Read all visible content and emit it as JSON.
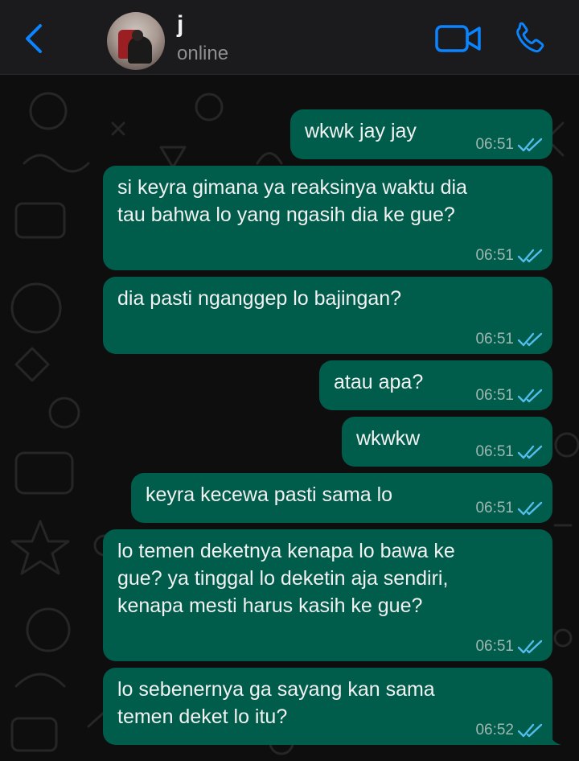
{
  "header": {
    "back_icon": "chevron-left-icon",
    "contact_name": "j",
    "contact_status": "online",
    "video_icon": "video-camera-icon",
    "call_icon": "phone-icon",
    "accent_color": "#0a84ff"
  },
  "messages": [
    {
      "text": "wkwk jay jay",
      "time": "06:51",
      "status": "read"
    },
    {
      "text": "si keyra gimana ya reaksinya waktu dia\ntau bahwa lo yang ngasih dia ke gue?",
      "time": "06:51",
      "status": "read"
    },
    {
      "text": "dia pasti nganggep lo bajingan?",
      "time": "06:51",
      "status": "read"
    },
    {
      "text": "atau apa?",
      "time": "06:51",
      "status": "read"
    },
    {
      "text": "wkwkw",
      "time": "06:51",
      "status": "read"
    },
    {
      "text": "keyra kecewa pasti sama lo",
      "time": "06:51",
      "status": "read"
    },
    {
      "text": "lo temen deketnya kenapa lo bawa ke\ngue? ya tinggal lo deketin aja sendiri,\nkenapa mesti harus kasih ke gue?",
      "time": "06:51",
      "status": "read"
    },
    {
      "text": "lo sebenernya ga sayang kan sama\ntemen deket lo itu?",
      "time": "06:52",
      "status": "read"
    }
  ],
  "colors": {
    "outgoing_bubble": "#005c4b",
    "read_ticks": "#53bdeb",
    "header_bg": "#1b1b1d"
  }
}
